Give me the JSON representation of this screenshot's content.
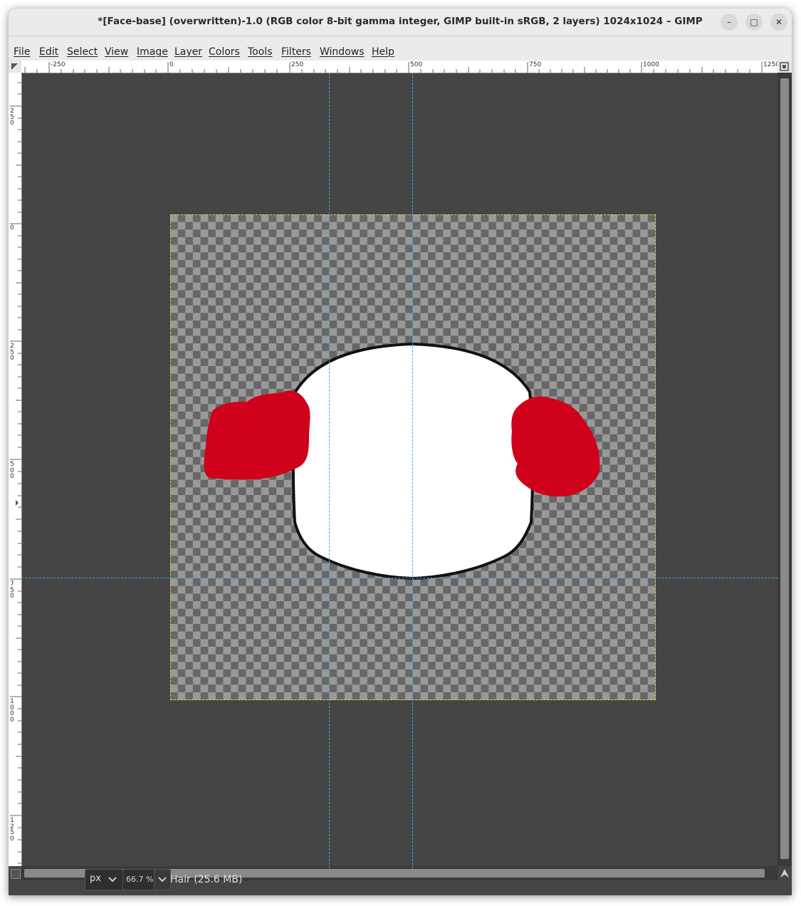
{
  "window": {
    "title": "*[Face-base] (overwritten)-1.0 (RGB color 8-bit gamma integer, GIMP built-in sRGB, 2 layers) 1024x1024 – GIMP",
    "controls": {
      "minimize": "–",
      "maximize": "□",
      "close": "✕"
    }
  },
  "menu": {
    "items": [
      "File",
      "Edit",
      "Select",
      "View",
      "Image",
      "Layer",
      "Colors",
      "Tools",
      "Filters",
      "Windows",
      "Help"
    ]
  },
  "rulers": {
    "horizontal": [
      "-250",
      "0",
      "250",
      "500",
      "750",
      "1000",
      "1250"
    ],
    "vertical": [
      "250",
      "0",
      "250",
      "500",
      "750",
      "1000",
      "1250"
    ]
  },
  "canvas": {
    "background_color": "#454545",
    "guide_color": "#3fa7d8",
    "boundary_color": "#e6d33a",
    "face_fill": "#ffffff",
    "face_outline": "#111111",
    "hair_color": "#d0021b"
  },
  "status": {
    "unit": "px",
    "zoom": "66.7 %",
    "layer_info": "Hair (25.6 MB)"
  }
}
